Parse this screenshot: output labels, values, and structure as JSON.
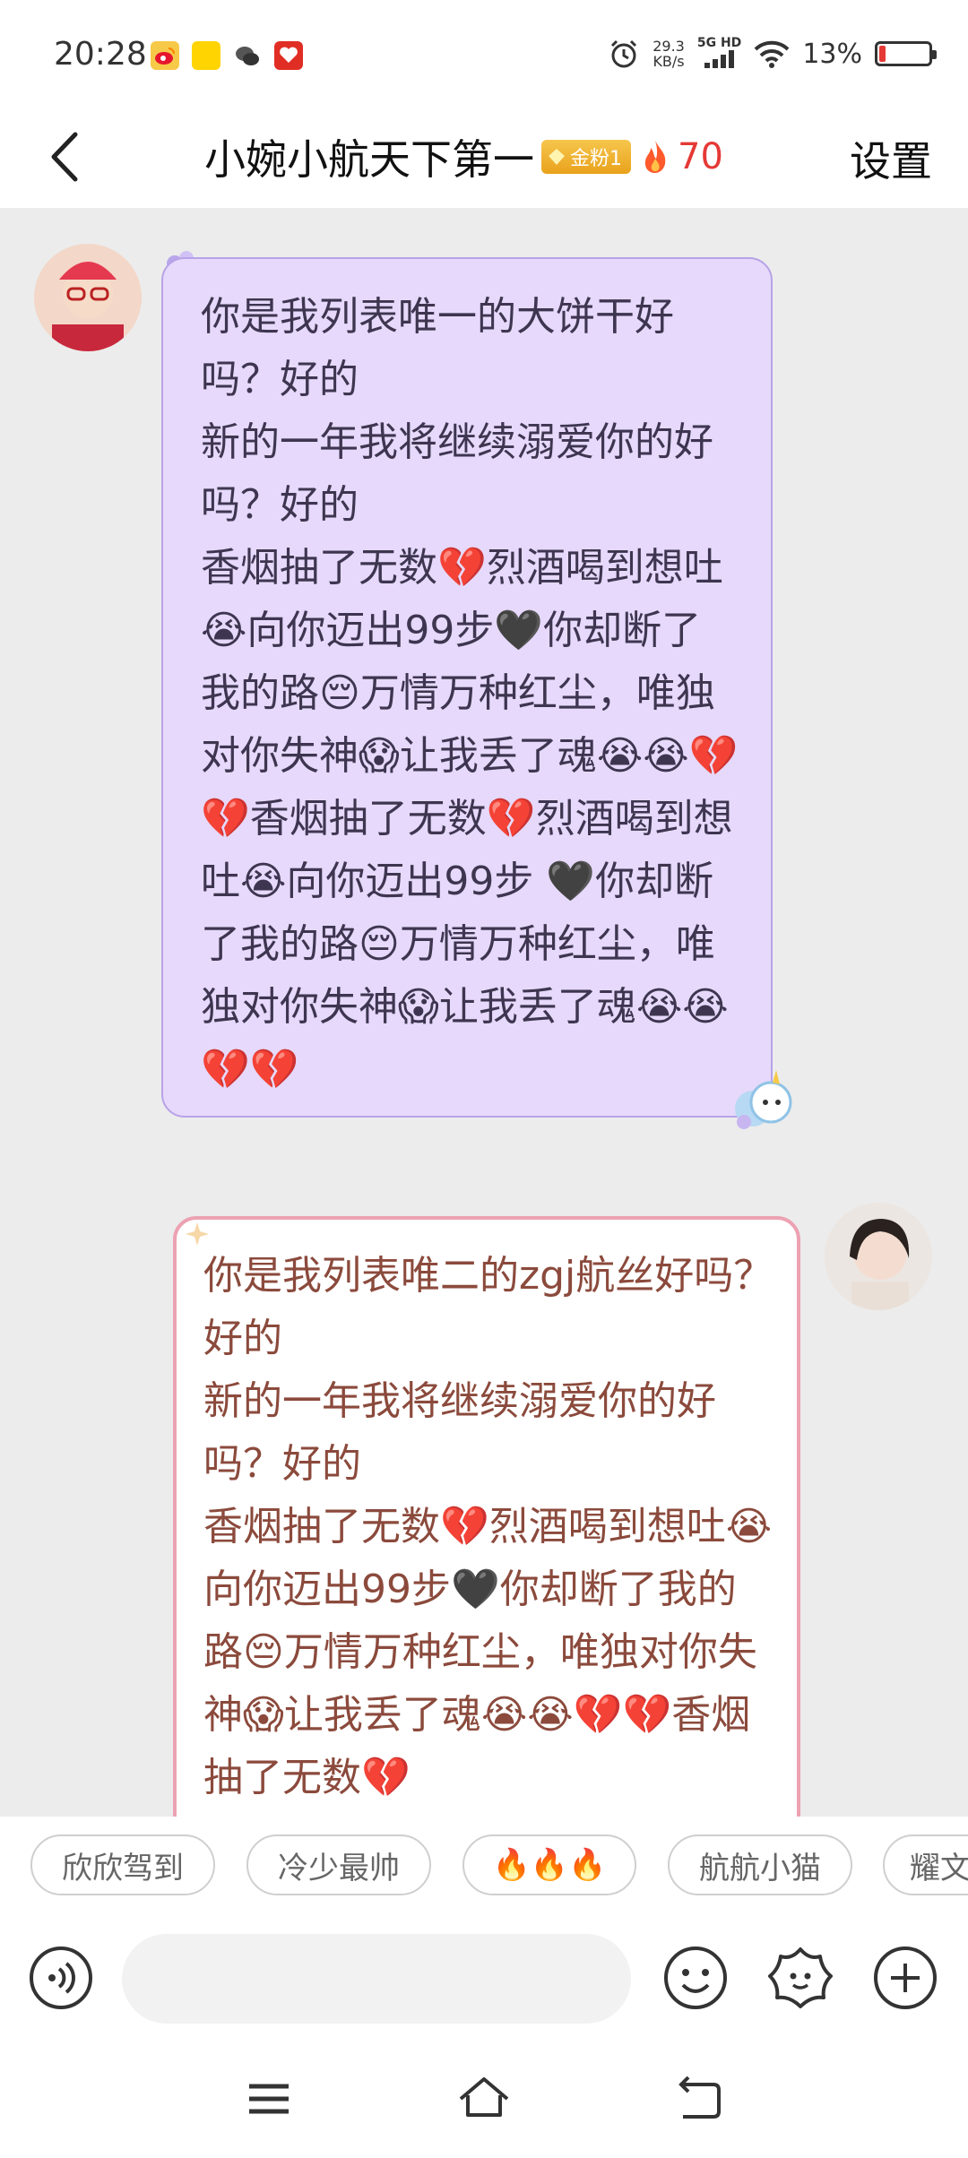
{
  "status_bar": {
    "time": "20:28",
    "net_speed_value": "29.3",
    "net_speed_unit": "KB/s",
    "network_type": "5G HD",
    "battery_percent": "13%",
    "battery_level": 0.13
  },
  "header": {
    "title": "小婉小航天下第一",
    "fan_badge": "金粉1",
    "heat_count": "70",
    "settings_label": "设置"
  },
  "messages": [
    {
      "side": "left",
      "text": "你是我列表唯一的大饼干好吗？好的\n新的一年我将继续溺爱你的好吗？好的\n香烟抽了无数💔烈酒喝到想吐😭向你迈出99步🖤你却断了我的路😔万情万种红尘，唯独对你失神😱让我丢了魂😭😭💔💔香烟抽了无数💔烈酒喝到想吐😭向你迈出99步 🖤你却断了我的路😔万情万种红尘，唯独对你失神😱让我丢了魂😭😭💔💔"
    },
    {
      "side": "right",
      "text": "你是我列表唯二的zgj航丝好吗？好的\n新的一年我将继续溺爱你的好吗？好的\n香烟抽了无数💔烈酒喝到想吐😭向你迈出99步🖤你却断了我的路😔万情万种红尘，唯独对你失神😱让我丢了魂😭😭💔💔香烟抽了无数💔"
    }
  ],
  "quick_replies": [
    "欣欣驾到",
    "冷少最帅",
    "🔥🔥🔥",
    "航航小猫",
    "耀文"
  ],
  "input": {
    "placeholder": ""
  },
  "colors": {
    "accent_red": "#e53935",
    "left_bubble_bg": "#e6d9fb",
    "left_bubble_border": "#b8a2e8",
    "right_bubble_border": "#eca2b2",
    "right_bubble_text": "#8b4a3c"
  },
  "icons": {
    "back": "chevron-left-icon",
    "voice": "voice-wave-icon",
    "emoji": "smiley-icon",
    "sticker": "flower-sticker-icon",
    "plus": "plus-icon",
    "nav_menu": "menu-lines-icon",
    "nav_home": "home-icon",
    "nav_back": "return-arrow-icon"
  }
}
